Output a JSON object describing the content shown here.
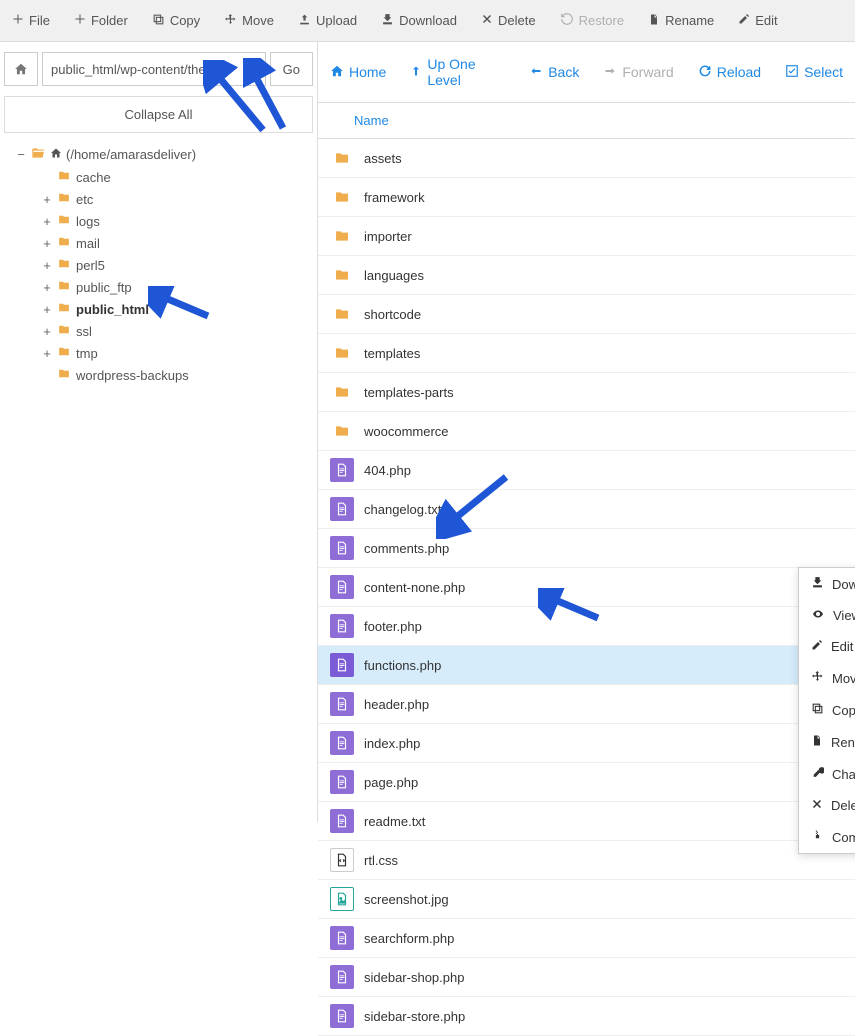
{
  "toolbar": [
    {
      "icon": "plus",
      "label": "File",
      "name": "file-button"
    },
    {
      "icon": "plus",
      "label": "Folder",
      "name": "folder-button"
    },
    {
      "icon": "copy",
      "label": "Copy",
      "name": "copy-button"
    },
    {
      "icon": "move",
      "label": "Move",
      "name": "move-button"
    },
    {
      "icon": "upload",
      "label": "Upload",
      "name": "upload-button"
    },
    {
      "icon": "download",
      "label": "Download",
      "name": "download-button"
    },
    {
      "icon": "delete",
      "label": "Delete",
      "name": "delete-button"
    },
    {
      "icon": "restore",
      "label": "Restore",
      "name": "restore-button",
      "disabled": true
    },
    {
      "icon": "rename",
      "label": "Rename",
      "name": "rename-button"
    },
    {
      "icon": "edit",
      "label": "Edit",
      "name": "edit-button"
    }
  ],
  "path_value": "public_html/wp-content/theme",
  "go_label": "Go",
  "collapse_label": "Collapse All",
  "tree_root": {
    "expander": "−",
    "label": "(/home/amarasdeliver)"
  },
  "tree_children": [
    {
      "exp": "",
      "label": "cache"
    },
    {
      "exp": "+",
      "label": "etc"
    },
    {
      "exp": "+",
      "label": "logs"
    },
    {
      "exp": "+",
      "label": "mail"
    },
    {
      "exp": "+",
      "label": "perl5"
    },
    {
      "exp": "+",
      "label": "public_ftp"
    },
    {
      "exp": "+",
      "label": "public_html",
      "bold": true
    },
    {
      "exp": "+",
      "label": "ssl"
    },
    {
      "exp": "+",
      "label": "tmp"
    },
    {
      "exp": "",
      "label": "wordpress-backups"
    }
  ],
  "nav": [
    {
      "icon": "home",
      "label": "Home",
      "name": "nav-home"
    },
    {
      "icon": "up",
      "label": "Up One Level",
      "name": "nav-up"
    },
    {
      "icon": "back",
      "label": "Back",
      "name": "nav-back"
    },
    {
      "icon": "forward",
      "label": "Forward",
      "name": "nav-forward",
      "disabled": true
    },
    {
      "icon": "reload",
      "label": "Reload",
      "name": "nav-reload"
    },
    {
      "icon": "select",
      "label": "Select",
      "name": "nav-select"
    }
  ],
  "column_header": "Name",
  "files": [
    {
      "type": "folder",
      "name": "assets"
    },
    {
      "type": "folder",
      "name": "framework"
    },
    {
      "type": "folder",
      "name": "importer"
    },
    {
      "type": "folder",
      "name": "languages"
    },
    {
      "type": "folder",
      "name": "shortcode"
    },
    {
      "type": "folder",
      "name": "templates"
    },
    {
      "type": "folder",
      "name": "templates-parts"
    },
    {
      "type": "folder",
      "name": "woocommerce"
    },
    {
      "type": "php",
      "name": "404.php"
    },
    {
      "type": "txt",
      "name": "changelog.txt"
    },
    {
      "type": "php",
      "name": "comments.php"
    },
    {
      "type": "php",
      "name": "content-none.php"
    },
    {
      "type": "php",
      "name": "footer.php"
    },
    {
      "type": "php",
      "name": "functions.php",
      "selected": true
    },
    {
      "type": "php",
      "name": "header.php"
    },
    {
      "type": "php",
      "name": "index.php"
    },
    {
      "type": "php",
      "name": "page.php"
    },
    {
      "type": "txt",
      "name": "readme.txt"
    },
    {
      "type": "css",
      "name": "rtl.css"
    },
    {
      "type": "jpg",
      "name": "screenshot.jpg"
    },
    {
      "type": "php",
      "name": "searchform.php"
    },
    {
      "type": "php",
      "name": "sidebar-shop.php"
    },
    {
      "type": "php",
      "name": "sidebar-store.php"
    }
  ],
  "context": [
    {
      "icon": "download",
      "label": "Download"
    },
    {
      "icon": "view",
      "label": "View"
    },
    {
      "icon": "edit",
      "label": "Edit"
    },
    {
      "icon": "move",
      "label": "Move"
    },
    {
      "icon": "copy",
      "label": "Copy"
    },
    {
      "icon": "rename",
      "label": "Rename"
    },
    {
      "icon": "perm",
      "label": "Change Permissions"
    },
    {
      "icon": "delete",
      "label": "Delete"
    },
    {
      "icon": "compress",
      "label": "Compress"
    }
  ]
}
